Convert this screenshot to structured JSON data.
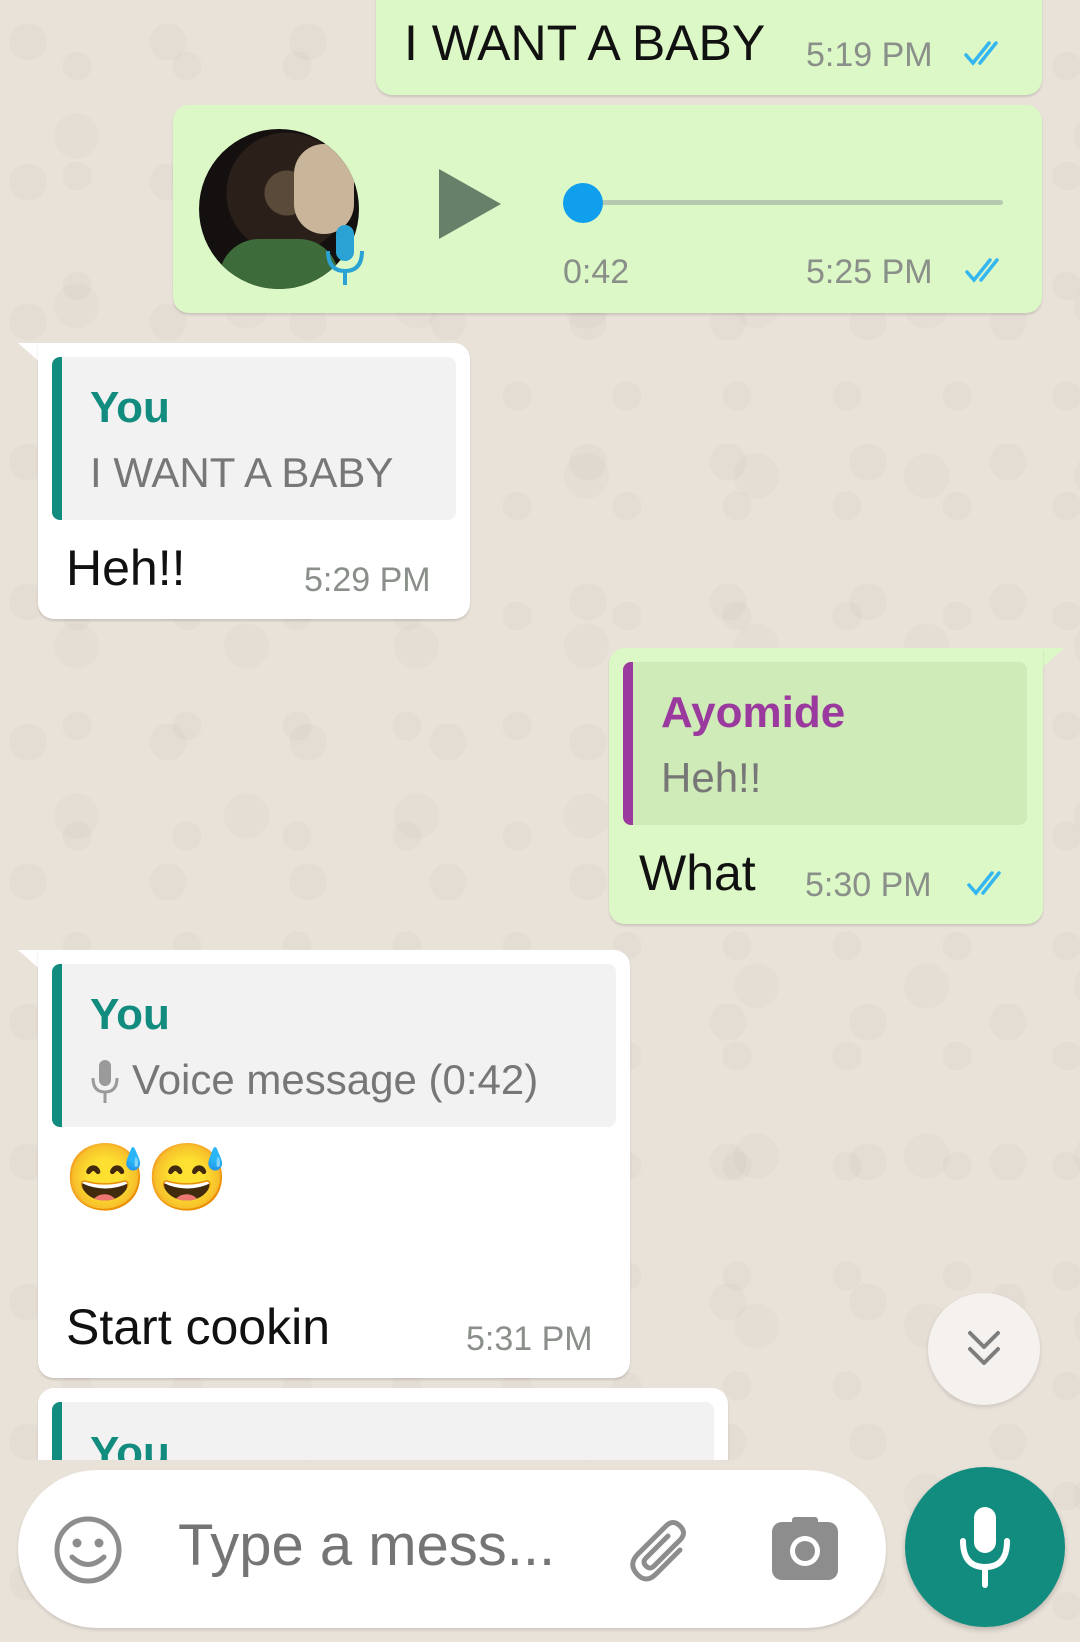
{
  "messages": {
    "m1": {
      "text": "I WANT A BABY",
      "time": "5:19 PM"
    },
    "m2": {
      "duration": "0:42",
      "time": "5:25 PM",
      "progress": 0
    },
    "m3": {
      "quote_author": "You",
      "quote_text": "I WANT A BABY",
      "text": "Heh!!",
      "time": "5:29 PM"
    },
    "m4": {
      "quote_author": "Ayomide",
      "quote_text": "Heh!!",
      "text": "What",
      "time": "5:30 PM"
    },
    "m5": {
      "quote_author": "You",
      "quote_text": "Voice message (0:42)",
      "emoji": "😅😅",
      "text": "Start cookin",
      "time": "5:31 PM"
    },
    "m6": {
      "quote_author": "You"
    }
  },
  "composer": {
    "placeholder": "Type a mess..."
  },
  "colors": {
    "outgoing_bubble": "#dcf8c6",
    "incoming_bubble": "#ffffff",
    "quote_you": "#128c7e",
    "quote_ayomide": "#9b3a9e",
    "read_ticks": "#34b7f1",
    "fab": "#128c7e"
  }
}
